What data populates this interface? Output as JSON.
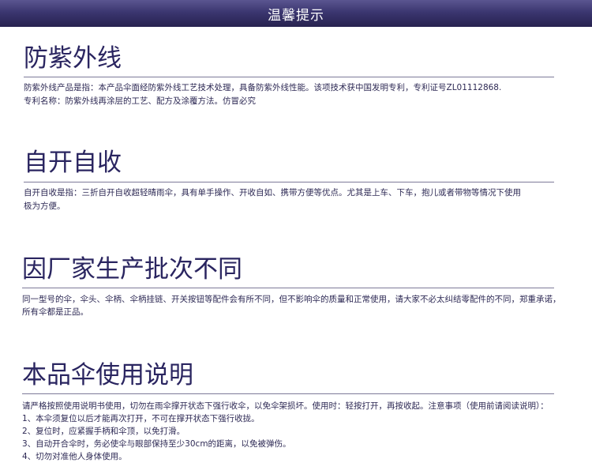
{
  "header": {
    "title": "温馨提示"
  },
  "sections": [
    {
      "title": "防紫外线",
      "lines": [
        "防紫外线产品是指：本产品伞面经防紫外线工艺技术处理，具备防紫外线性能。该项技术获中国发明专利，专利证号ZL01112868.",
        "专利名称：防紫外线再涂层的工艺、配方及涂覆方法。仿冒必究"
      ]
    },
    {
      "title": "自开自收",
      "lines": [
        "自开自收是指：三折自开自收超轻晴雨伞，具有单手操作、开收自如、携带方便等优点。尤其是上车、下车，抱儿或者带物等情况下使用",
        "极为方便。"
      ]
    },
    {
      "title": "因厂家生产批次不同",
      "lines": [
        "同一型号的伞，伞头、伞柄、伞柄挂链、开关按钮等配件会有所不同，但不影响伞的质量和正常使用，请大家不必太纠结零配件的不同，郑重承诺，",
        "所有伞都是正品。"
      ]
    },
    {
      "title": "本品伞使用说明",
      "lines": [
        "请严格按照使用说明书使用，切勿在雨伞撑开状态下强行收伞，以免伞架损坏。使用时：轻按打开，再按收起。注意事项（使用前请阅读说明）：",
        "1、本伞须复位以后才能再次打开，不可在撑开状态下强行收拢。",
        "2、复位时，应紧握手柄和伞顶，以免打滑。",
        "3、自动开合伞时，务必使伞与眼部保持至少30cm的距离，以免被弹伤。",
        "4、切勿对准他人身体使用。"
      ]
    }
  ]
}
